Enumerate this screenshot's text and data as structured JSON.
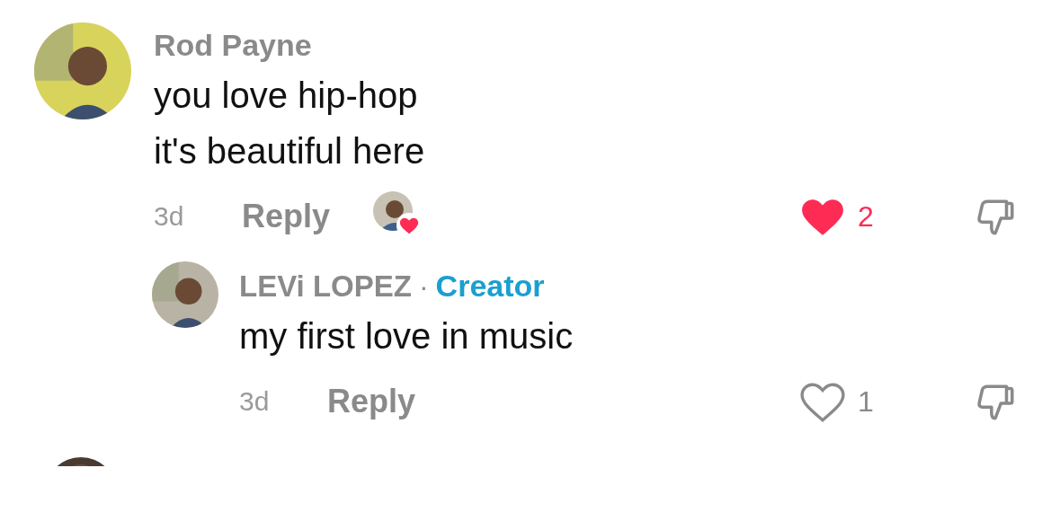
{
  "comments": [
    {
      "author": "Rod Payne",
      "text_lines": [
        "you love hip-hop",
        "it's beautiful here"
      ],
      "time": "3d",
      "reply_label": "Reply",
      "creator_liked": true,
      "liked": true,
      "like_count": "2",
      "replies": [
        {
          "author": "LEVi LOPEZ",
          "separator": "·",
          "badge": "Creator",
          "text_lines": [
            "my first love in music"
          ],
          "time": "3d",
          "reply_label": "Reply",
          "liked": false,
          "like_count": "1"
        }
      ]
    }
  ]
}
